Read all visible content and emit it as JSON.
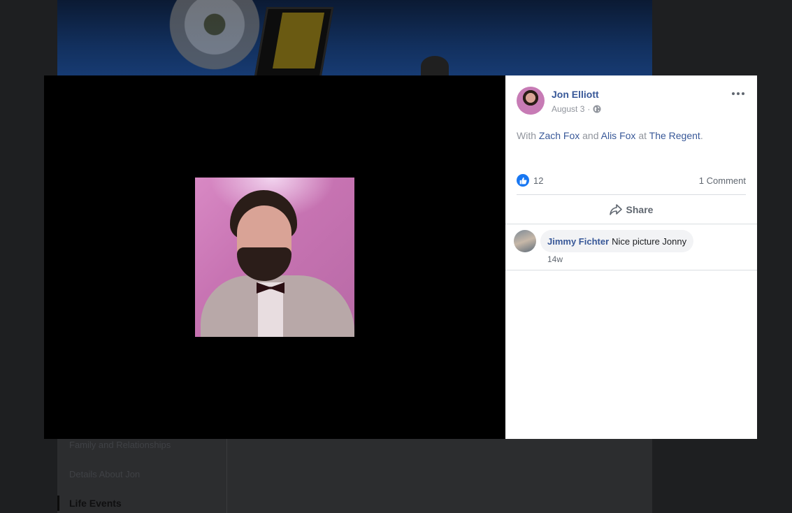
{
  "background_page": {
    "nav_items": [
      "Family and Relationships",
      "Details About Jon"
    ],
    "active_nav_item": "Life Events"
  },
  "post": {
    "author": "Jon Elliott",
    "date": "August 3",
    "date_separator": "·",
    "privacy_icon": "globe-icon",
    "caption": {
      "with_word": "With",
      "tagged_1": "Zach Fox",
      "and_word": "and",
      "tagged_2": "Alis Fox",
      "at_word": "at",
      "location": "The Regent",
      "period": "."
    },
    "like_count": "12",
    "comment_count_label": "1 Comment",
    "share_label": "Share",
    "comments": [
      {
        "author": "Jimmy Fichter",
        "text": "Nice picture Jonny",
        "time": "14w"
      }
    ]
  },
  "colors": {
    "link": "#385898",
    "like_blue": "#1877f2",
    "muted": "#90949c"
  }
}
